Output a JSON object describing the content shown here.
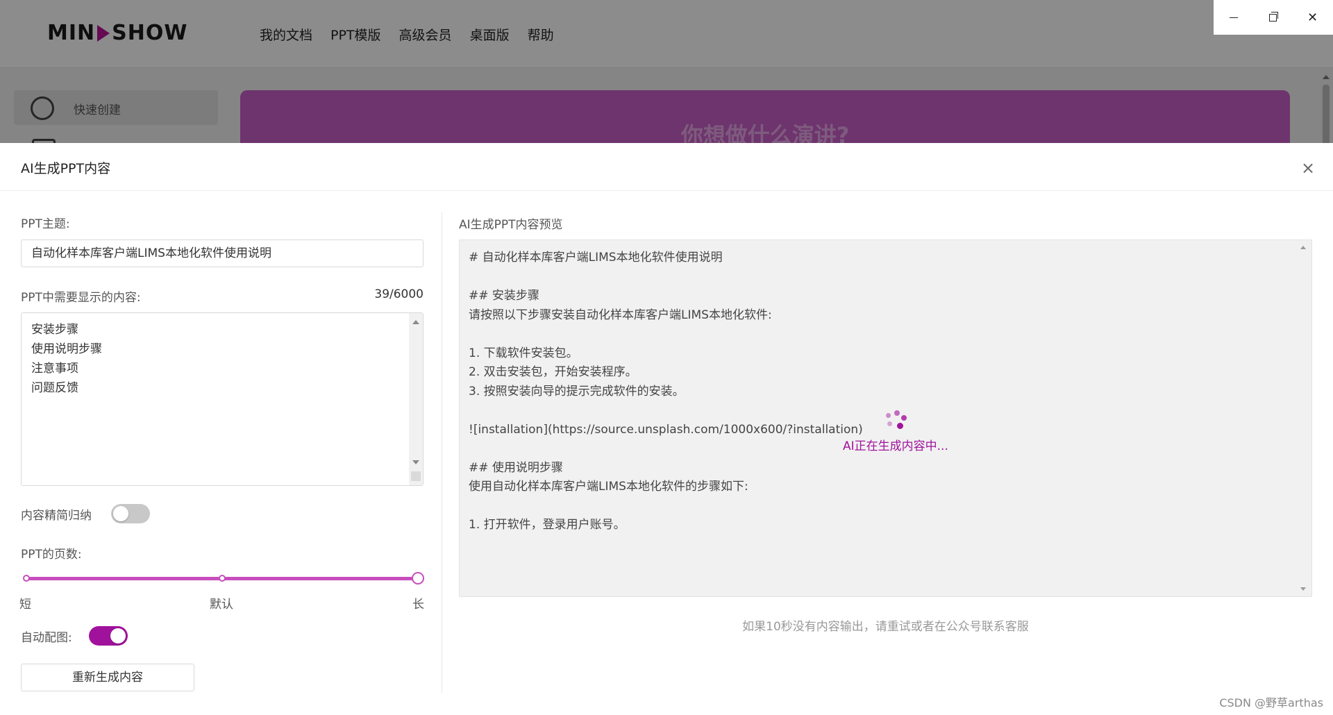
{
  "app": {
    "logo": {
      "left": "MIN",
      "right": "SHOW"
    },
    "nav": [
      "我的文档",
      "PPT模版",
      "高级会员",
      "桌面版",
      "帮助"
    ],
    "sidebar_item": "快速创建",
    "banner_text": "你想做什么演讲?"
  },
  "window_controls": {
    "close": "✕"
  },
  "dialog": {
    "title": "AI生成PPT内容",
    "close": "×",
    "topic_label": "PPT主题:",
    "topic_value": "自动化样本库客户端LIMS本地化软件使用说明",
    "content_label": "PPT中需要显示的内容:",
    "content_count": "39/6000",
    "content_lines": [
      "安装步骤",
      "使用说明步骤",
      "注意事项",
      "问题反馈"
    ],
    "summarize_label": "内容精简归纳",
    "summarize_on": false,
    "pages_label": "PPT的页数:",
    "pages_options": [
      "短",
      "默认",
      "长"
    ],
    "pages_value": 1.0,
    "auto_image_label": "自动配图:",
    "auto_image_on": true,
    "regen_button": "重新生成内容",
    "preview_label": "AI生成PPT内容预览",
    "preview_lines": [
      "# 自动化样本库客户端LIMS本地化软件使用说明",
      "",
      "## 安装步骤",
      "请按照以下步骤安装自动化样本库客户端LIMS本地化软件:",
      "",
      "1. 下载软件安装包。",
      "2. 双击安装包，开始安装程序。",
      "3. 按照安装向导的提示完成软件的安装。",
      "",
      "![installation](https://source.unsplash.com/1000x600/?installation)",
      "",
      "## 使用说明步骤",
      "使用自动化样本库客户端LIMS本地化软件的步骤如下:",
      "",
      "1. 打开软件，登录用户账号。"
    ],
    "generating_text": "AI正在生成内容中...",
    "hint": "如果10秒没有内容输出，请重试或者在公众号联系客服"
  },
  "watermark": "CSDN @野草arthas",
  "colors": {
    "accent": "#a0129c",
    "slider": "#c84dbd",
    "banner": "#c85fc6"
  }
}
